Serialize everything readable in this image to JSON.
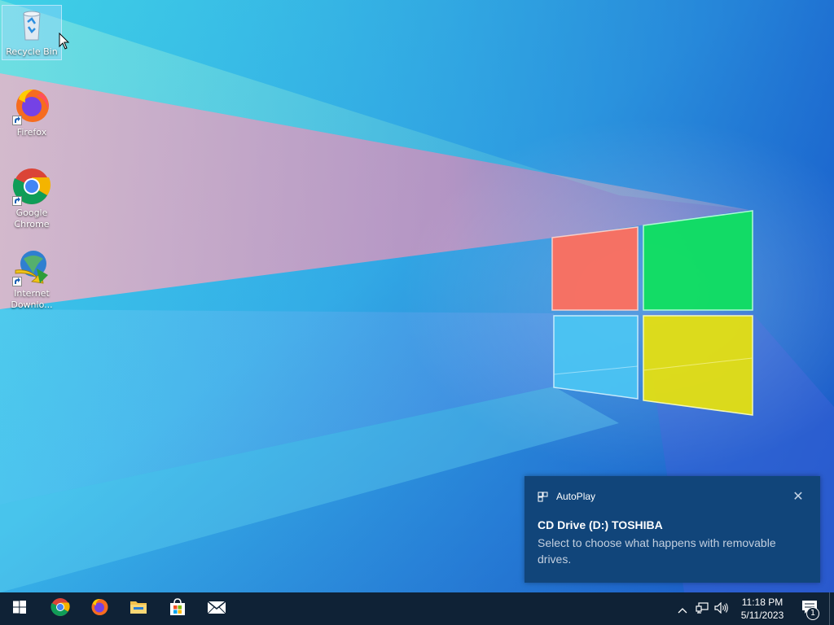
{
  "desktop": {
    "icons": [
      {
        "label": "Recycle Bin",
        "icon": "recycle-bin-icon"
      },
      {
        "label": "Firefox",
        "icon": "firefox-icon"
      },
      {
        "label": "Google Chrome",
        "icon": "chrome-icon"
      },
      {
        "label": "Internet Downlo...",
        "icon": "internet-download-manager-icon"
      }
    ]
  },
  "toast": {
    "app_name": "AutoPlay",
    "title": "CD Drive (D:) TOSHIBA",
    "body": "Select to choose what happens with removable drives.",
    "close_glyph": "✕",
    "background": "#11457a"
  },
  "taskbar": {
    "background": "#0f2236",
    "pinned": [
      {
        "icon": "chrome-icon"
      },
      {
        "icon": "firefox-icon"
      },
      {
        "icon": "file-explorer-icon"
      },
      {
        "icon": "microsoft-store-icon"
      },
      {
        "icon": "mail-icon"
      }
    ],
    "tray": {
      "chevron_glyph": "^",
      "time": "11:18 PM",
      "date": "5/11/2023",
      "notification_count": "1"
    }
  }
}
